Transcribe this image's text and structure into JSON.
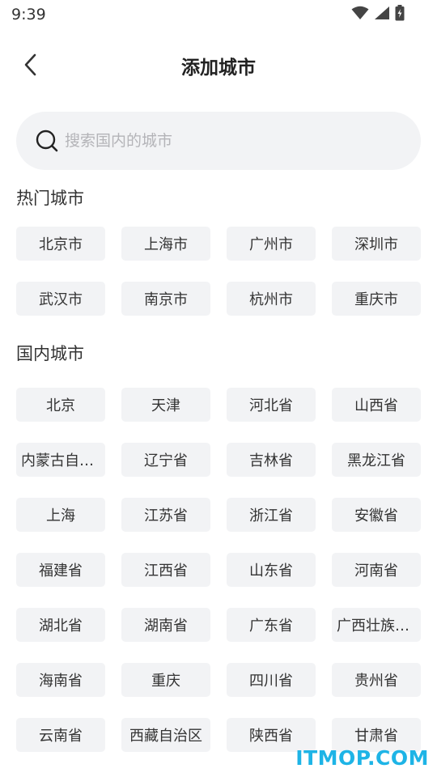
{
  "status_bar": {
    "time": "9:39"
  },
  "header": {
    "title": "添加城市"
  },
  "search": {
    "placeholder": "搜索国内的城市",
    "value": ""
  },
  "hot_cities": {
    "title": "热门城市",
    "items": [
      "北京市",
      "上海市",
      "广州市",
      "深圳市",
      "武汉市",
      "南京市",
      "杭州市",
      "重庆市"
    ]
  },
  "domestic": {
    "title": "国内城市",
    "items": [
      "北京",
      "天津",
      "河北省",
      "山西省",
      "内蒙古自治区",
      "辽宁省",
      "吉林省",
      "黑龙江省",
      "上海",
      "江苏省",
      "浙江省",
      "安徽省",
      "福建省",
      "江西省",
      "山东省",
      "河南省",
      "湖北省",
      "湖南省",
      "广东省",
      "广西壮族自治区",
      "海南省",
      "重庆",
      "四川省",
      "贵州省",
      "云南省",
      "西藏自治区",
      "陕西省",
      "甘肃省"
    ]
  },
  "watermark": "ITMOP.COM",
  "colors": {
    "chip_bg": "#f2f3f5",
    "watermark": "#1eb4e6"
  }
}
